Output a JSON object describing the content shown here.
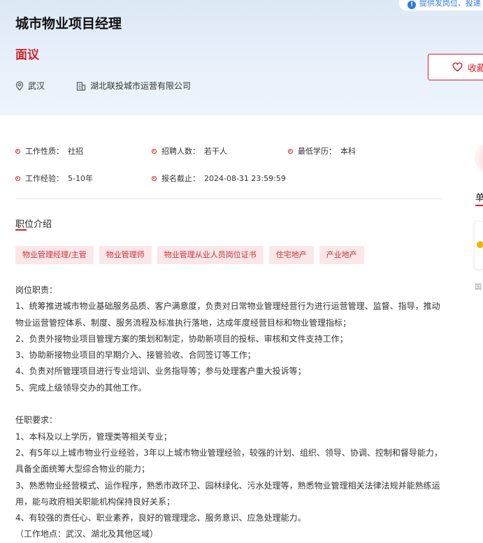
{
  "notice": {
    "text": "提供发岗位、投递"
  },
  "job": {
    "title": "城市物业项目经理",
    "salary": "面议",
    "location": "武汉",
    "company": "湖北联投城市运营有限公司"
  },
  "actions": {
    "favorite_label": "收藏"
  },
  "info": [
    {
      "label": "工作性质：",
      "value": "社招"
    },
    {
      "label": "招聘人数：",
      "value": "若干人"
    },
    {
      "label": "最低学历：",
      "value": "本科"
    },
    {
      "label": "工作经验：",
      "value": "5-10年"
    },
    {
      "label": "报名截止：",
      "value": "2024-08-31 23:59:59"
    }
  ],
  "section": {
    "title": "职位介绍"
  },
  "tags": [
    "物业管理经理/主管",
    "物业管理师",
    "物业管理从业人员岗位证书",
    "住宅地产",
    "产业地产"
  ],
  "description": [
    "岗位职责：",
    "1、统筹推进城市物业基础服务品质、客户满意度，负责对日常物业管理经营行为进行运营管理、监督、指导，推动",
    "物业运营管控体系、制度、服务流程及标准执行落地，达成年度经营目标和物业管理指标；",
    "2、负责外接物业项目管理方案的策划和制定，协助新项目的投标、审核和文件支持工作；",
    "3、协助新接物业项目的早期介入、接管验收、合同签订等工作；",
    "4、负责对所管理项目进行专业培训、业务指导等；参与处理客户重大投诉等；",
    "5、完成上级领导交办的其他工作。",
    "",
    "任职要求：",
    "1、本科及以上学历，管理类等相关专业；",
    "2、有5年以上城市物业行业经验，3年以上城市物业管理经验，较强的计划、组织、领导、协调、控制和督导能力，",
    "具备全面统筹大型综合物业的能力；",
    "3、熟悉物业经营模式、运作程序，熟悉市政环卫、园林绿化、污水处理等，熟悉物业管理相关法律法规并能熟练运",
    "用，能与政府相关职能机构保持良好关系；",
    "4、有较强的责任心、职业素养，良好的管理理念、服务意识、应急处理能力。",
    "（工作地点：武汉、湖北及其他区域）"
  ],
  "sidebar": {
    "heading_char": "单",
    "small_text": "国"
  }
}
